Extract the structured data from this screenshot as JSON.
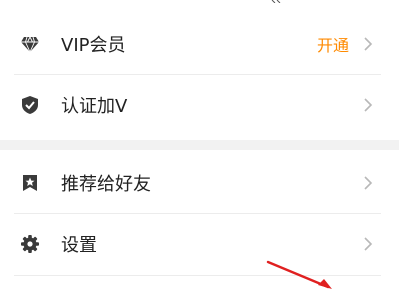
{
  "menu": {
    "items": [
      {
        "id": "vip",
        "label": "VIP会员",
        "icon": "diamond-icon",
        "action": "开通"
      },
      {
        "id": "verify",
        "label": "认证加V",
        "icon": "shield-check-icon"
      },
      {
        "id": "recommend",
        "label": "推荐给好友",
        "icon": "star-bookmark-icon"
      },
      {
        "id": "settings",
        "label": "设置",
        "icon": "gear-icon"
      }
    ]
  },
  "colors": {
    "accent": "#ff8a00",
    "icon": "#3a3a3a",
    "chevron": "#b8b8b8",
    "divider": "#ececec",
    "section_gap": "#f2f2f2",
    "annotation_arrow": "#e02020"
  }
}
